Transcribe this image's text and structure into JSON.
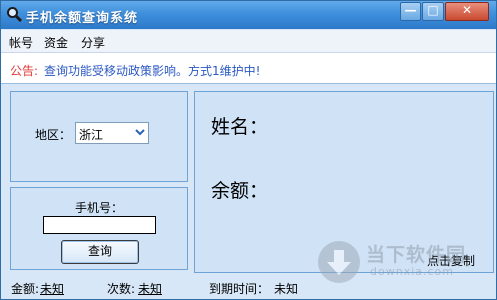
{
  "window": {
    "title": "手机余额查询系统",
    "controls": {
      "minimize": "—",
      "maximize": "□",
      "close": "✕"
    }
  },
  "menu": [
    "帐号",
    "资金",
    "分享"
  ],
  "notice": {
    "prefix": "公告:",
    "text": "查询功能受移动政策影响。方式1维护中!"
  },
  "region": {
    "label": "地区：",
    "selected": "浙江"
  },
  "phone": {
    "label": "手机号：",
    "value": "",
    "query_label": "查询"
  },
  "result": {
    "name_label": "姓名：",
    "balance_label": "余额：",
    "copy_label": "点击复制"
  },
  "status": {
    "amount_label": "金额:",
    "amount_value": "未知",
    "count_label": "次数:",
    "count_value": "未知",
    "expire_label": "到期时间：",
    "expire_value": "未知"
  },
  "watermark": {
    "title": "当下软件园",
    "subtitle": "downxia.com"
  },
  "colors": {
    "titlebar": "#3f8fdc",
    "notice_prefix": "#e33a3a",
    "notice_text": "#2b59c3",
    "panel_bg": "#cfe2f6"
  },
  "icons": [
    "magnifier-app-icon",
    "chevron-down-icon",
    "download-arrow-icon"
  ]
}
